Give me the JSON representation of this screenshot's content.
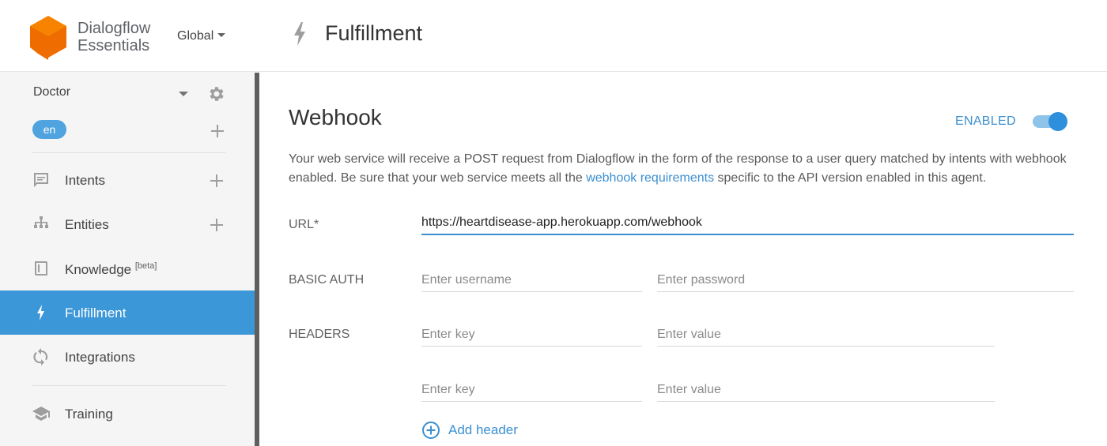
{
  "brand": {
    "line1": "Dialogflow",
    "line2": "Essentials",
    "region": "Global",
    "logo_color": "#ef6c00"
  },
  "agent": {
    "name": "Doctor",
    "language": "en"
  },
  "nav": {
    "items": [
      {
        "label": "Intents",
        "icon": "chat-bubble-icon",
        "has_add": true
      },
      {
        "label": "Entities",
        "icon": "hierarchy-icon",
        "has_add": true
      },
      {
        "label": "Knowledge",
        "badge": "[beta]",
        "icon": "book-icon"
      },
      {
        "label": "Fulfillment",
        "icon": "bolt-icon",
        "active": true
      },
      {
        "label": "Integrations",
        "icon": "sync-icon"
      },
      {
        "label": "Training",
        "icon": "graduation-cap-icon"
      }
    ]
  },
  "page": {
    "title": "Fulfillment"
  },
  "webhook": {
    "title": "Webhook",
    "status_label": "ENABLED",
    "enabled": true,
    "accent": "#3b97d8",
    "description_pre": "Your web service will receive a POST request from Dialogflow in the form of the response to a user query matched by intents with webhook enabled. Be sure that your web service meets all the ",
    "description_link": "webhook requirements",
    "description_post": " specific to the API version enabled in this agent.",
    "url_label": "URL*",
    "url_value": "https://heartdisease-app.herokuapp.com/webhook",
    "basic_auth_label": "BASIC AUTH",
    "username_placeholder": "Enter username",
    "password_placeholder": "Enter password",
    "headers_label": "HEADERS",
    "headers": [
      {
        "key_placeholder": "Enter key",
        "value_placeholder": "Enter value"
      },
      {
        "key_placeholder": "Enter key",
        "value_placeholder": "Enter value"
      }
    ],
    "add_header_label": "Add header"
  }
}
